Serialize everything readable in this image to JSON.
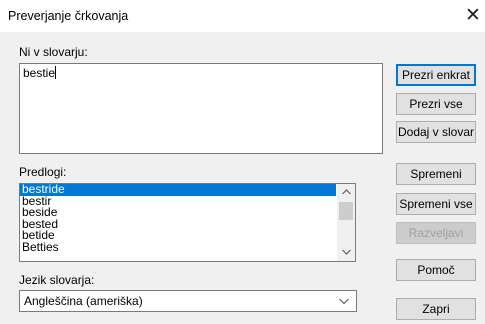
{
  "window": {
    "title": "Preverjanje črkovanja",
    "close_glyph": "✕"
  },
  "not_in_dictionary": {
    "label": "Ni v slovarju:",
    "value": "bestie"
  },
  "suggestions": {
    "label": "Predlogi:",
    "items": [
      "bestride",
      "bestir",
      "beside",
      "bested",
      "betide",
      "Betties"
    ],
    "selected_index": 0
  },
  "dictionary_language": {
    "label": "Jezik slovarja:",
    "selected": "Angleščina (ameriška)"
  },
  "buttons": {
    "ignore_once": "Prezri enkrat",
    "ignore_all": "Prezri vse",
    "add_to_dictionary": "Dodaj v slovar",
    "change": "Spremeni",
    "change_all": "Spremeni vse",
    "undo": "Razveljavi",
    "help": "Pomoč",
    "close": "Zapri"
  },
  "icons": {
    "close": "close-icon",
    "scroll_up": "chevron-up-icon",
    "scroll_down": "chevron-down-icon",
    "dropdown": "chevron-down-icon"
  }
}
